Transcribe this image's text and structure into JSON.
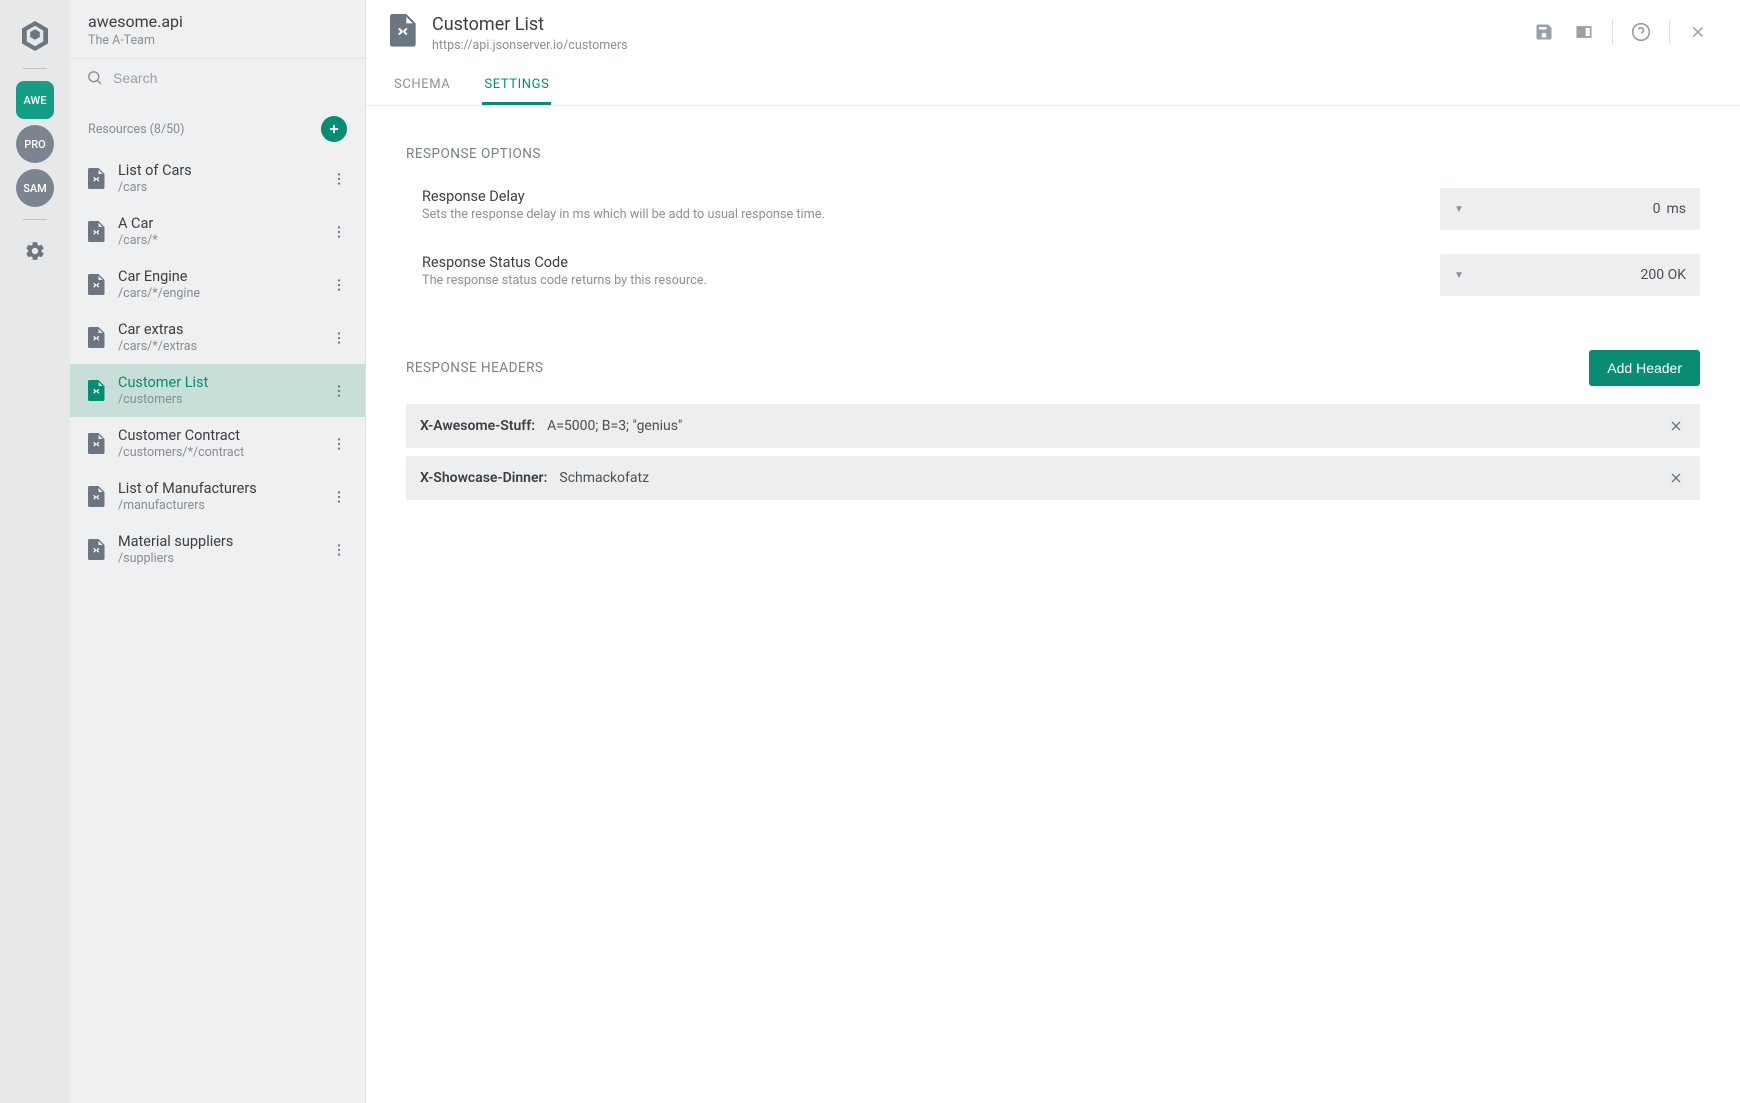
{
  "app": {
    "name": "awesome.api",
    "team": "The A-Team"
  },
  "rail": {
    "badges": [
      {
        "label": "AWE",
        "active": true,
        "round": false
      },
      {
        "label": "PRO",
        "active": false,
        "round": true
      },
      {
        "label": "SAM",
        "active": false,
        "round": true
      }
    ]
  },
  "sidebar": {
    "search_placeholder": "Search",
    "resources_label": "Resources (8/50)",
    "items": [
      {
        "title": "List of Cars",
        "path": "/cars",
        "active": false
      },
      {
        "title": "A Car",
        "path": "/cars/*",
        "active": false
      },
      {
        "title": "Car Engine",
        "path": "/cars/*/engine",
        "active": false
      },
      {
        "title": "Car extras",
        "path": "/cars/*/extras",
        "active": false
      },
      {
        "title": "Customer List",
        "path": "/customers",
        "active": true
      },
      {
        "title": "Customer Contract",
        "path": "/customers/*/contract",
        "active": false
      },
      {
        "title": "List of Manufacturers",
        "path": "/manufacturers",
        "active": false
      },
      {
        "title": "Material suppliers",
        "path": "/suppliers",
        "active": false
      }
    ]
  },
  "header": {
    "title": "Customer List",
    "url": "https://api.jsonserver.io/customers",
    "tabs": [
      {
        "label": "SCHEMA",
        "active": false
      },
      {
        "label": "SETTINGS",
        "active": true
      }
    ]
  },
  "settings": {
    "response_options_title": "RESPONSE OPTIONS",
    "options": [
      {
        "label": "Response Delay",
        "desc": "Sets the response delay in ms which will be add to usual response time.",
        "value": "0",
        "unit": "ms",
        "has_unit": true
      },
      {
        "label": "Response Status Code",
        "desc": "The response status code returns by this resource.",
        "value": "200 OK",
        "unit": "",
        "has_unit": false
      }
    ],
    "response_headers_title": "RESPONSE HEADERS",
    "add_header_label": "Add Header",
    "headers": [
      {
        "name": "X-Awesome-Stuff:",
        "value": "A=5000; B=3; \"genius\""
      },
      {
        "name": "X-Showcase-Dinner:",
        "value": "Schmackofatz"
      }
    ]
  }
}
